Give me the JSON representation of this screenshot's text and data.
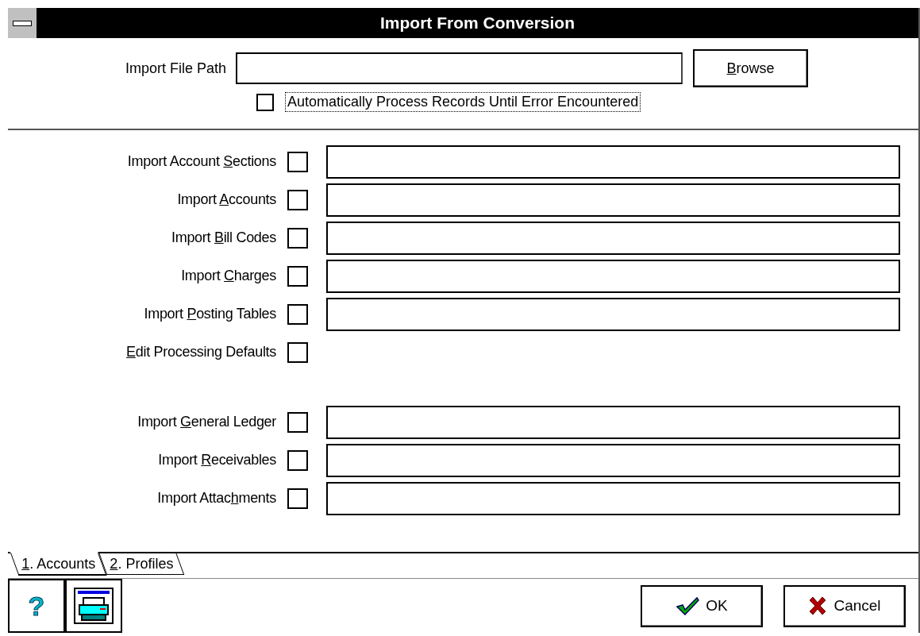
{
  "window": {
    "title": "Import From Conversion"
  },
  "file_path": {
    "label": "Import File Path"
  },
  "browse_button": {
    "label": [
      {
        "text": "B",
        "underline": true
      },
      {
        "text": "rowse",
        "underline": false
      }
    ]
  },
  "auto_process": {
    "label": "Automatically Process Records Until Error Encountered",
    "checked": false,
    "focused": true
  },
  "option_groups": [
    [
      {
        "label": [
          {
            "text": "Import Account ",
            "underline": false
          },
          {
            "text": "S",
            "underline": true
          },
          {
            "text": "ections",
            "underline": false
          }
        ],
        "checked": false,
        "has_field": true
      },
      {
        "label": [
          {
            "text": "Import ",
            "underline": false
          },
          {
            "text": "A",
            "underline": true
          },
          {
            "text": "ccounts",
            "underline": false
          }
        ],
        "checked": false,
        "has_field": true
      },
      {
        "label": [
          {
            "text": "Import ",
            "underline": false
          },
          {
            "text": "B",
            "underline": true
          },
          {
            "text": "ill Codes",
            "underline": false
          }
        ],
        "checked": false,
        "has_field": true
      },
      {
        "label": [
          {
            "text": "Import ",
            "underline": false
          },
          {
            "text": "C",
            "underline": true
          },
          {
            "text": "harges",
            "underline": false
          }
        ],
        "checked": false,
        "has_field": true
      },
      {
        "label": [
          {
            "text": "Import ",
            "underline": false
          },
          {
            "text": "P",
            "underline": true
          },
          {
            "text": "osting Tables",
            "underline": false
          }
        ],
        "checked": false,
        "has_field": true
      },
      {
        "label": [
          {
            "text": "E",
            "underline": true
          },
          {
            "text": "dit Processing Defaults",
            "underline": false
          }
        ],
        "checked": false,
        "has_field": false
      }
    ],
    [
      {
        "label": [
          {
            "text": "Import ",
            "underline": false
          },
          {
            "text": "G",
            "underline": true
          },
          {
            "text": "eneral Ledger",
            "underline": false
          }
        ],
        "checked": false,
        "has_field": true
      },
      {
        "label": [
          {
            "text": "Import ",
            "underline": false
          },
          {
            "text": "R",
            "underline": true
          },
          {
            "text": "eceivables",
            "underline": false
          }
        ],
        "checked": false,
        "has_field": true
      },
      {
        "label": [
          {
            "text": "Import Attac",
            "underline": false
          },
          {
            "text": "h",
            "underline": true
          },
          {
            "text": "ments",
            "underline": false
          }
        ],
        "checked": false,
        "has_field": true
      }
    ]
  ],
  "tabs": [
    {
      "label": [
        {
          "text": "1",
          "underline": true
        },
        {
          "text": ". Accounts",
          "underline": false
        }
      ],
      "selected": true
    },
    {
      "label": [
        {
          "text": "2",
          "underline": true
        },
        {
          "text": ". Profiles",
          "underline": false
        }
      ],
      "selected": false
    }
  ],
  "help_button": {
    "label": "?"
  },
  "buttons": [
    {
      "kind": "ok",
      "label": "OK"
    },
    {
      "kind": "cancel",
      "label": "Cancel"
    }
  ]
}
